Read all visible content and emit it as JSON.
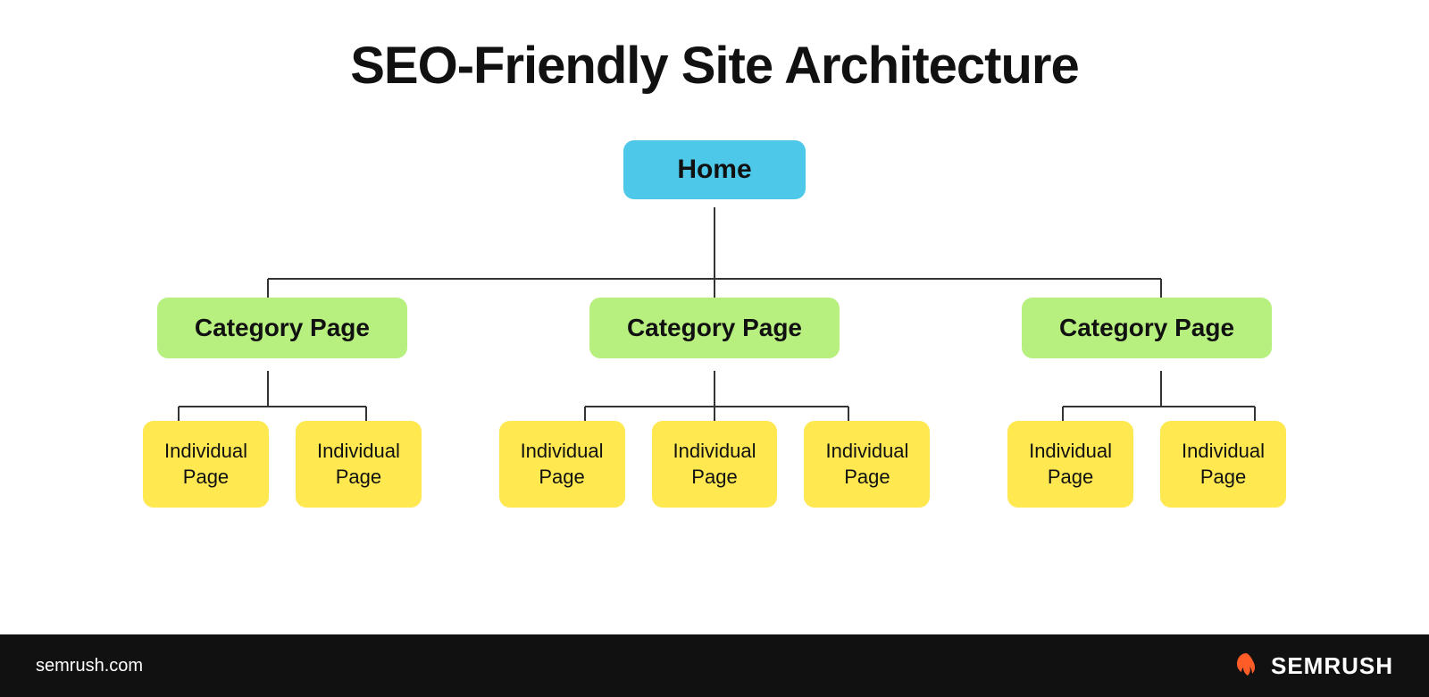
{
  "title": "SEO-Friendly Site Architecture",
  "home": {
    "label": "Home"
  },
  "categories": [
    {
      "label": "Category Page"
    },
    {
      "label": "Category Page"
    },
    {
      "label": "Category Page"
    }
  ],
  "individual_pages": [
    [
      {
        "label": "Individual\nPage"
      },
      {
        "label": "Individual\nPage"
      }
    ],
    [
      {
        "label": "Individual\nPage"
      },
      {
        "label": "Individual\nPage"
      },
      {
        "label": "Individual\nPage"
      }
    ],
    [
      {
        "label": "Individual\nPage"
      },
      {
        "label": "Individual\nPage"
      }
    ]
  ],
  "footer": {
    "url": "semrush.com",
    "brand": "SEMRUSH"
  },
  "colors": {
    "home_bg": "#4dc8e8",
    "category_bg": "#b8f080",
    "individual_bg": "#ffe850",
    "footer_bg": "#111111",
    "footer_text": "#ffffff",
    "semrush_orange": "#ff5c28"
  }
}
